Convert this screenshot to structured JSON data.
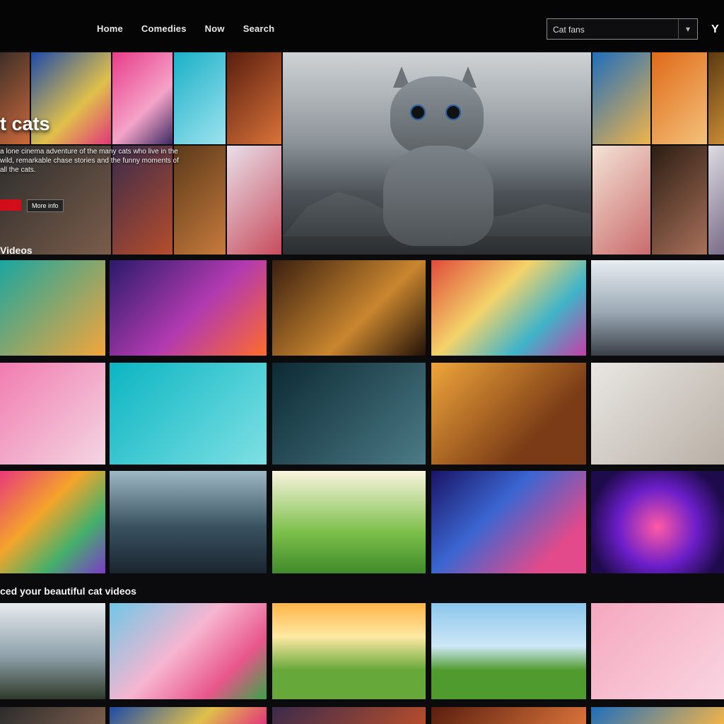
{
  "header": {
    "nav": [
      "Home",
      "Comedies",
      "Now",
      "Search"
    ],
    "search": {
      "value": "Cat fans",
      "button_icon": "dropdown-icon"
    },
    "brand": "Y"
  },
  "hero": {
    "title": "t cats",
    "description": "a lone cinema adventure of the many cats who live in the wild, remarkable chase stories and the funny moments of all the cats.",
    "play_label": "",
    "info_label": "More info"
  },
  "rows": [
    {
      "label": "Videos"
    },
    {
      "label": "ced your beautiful cat videos"
    }
  ],
  "colors": {
    "background": "#0b0b0d",
    "accent": "#d40d1a"
  }
}
